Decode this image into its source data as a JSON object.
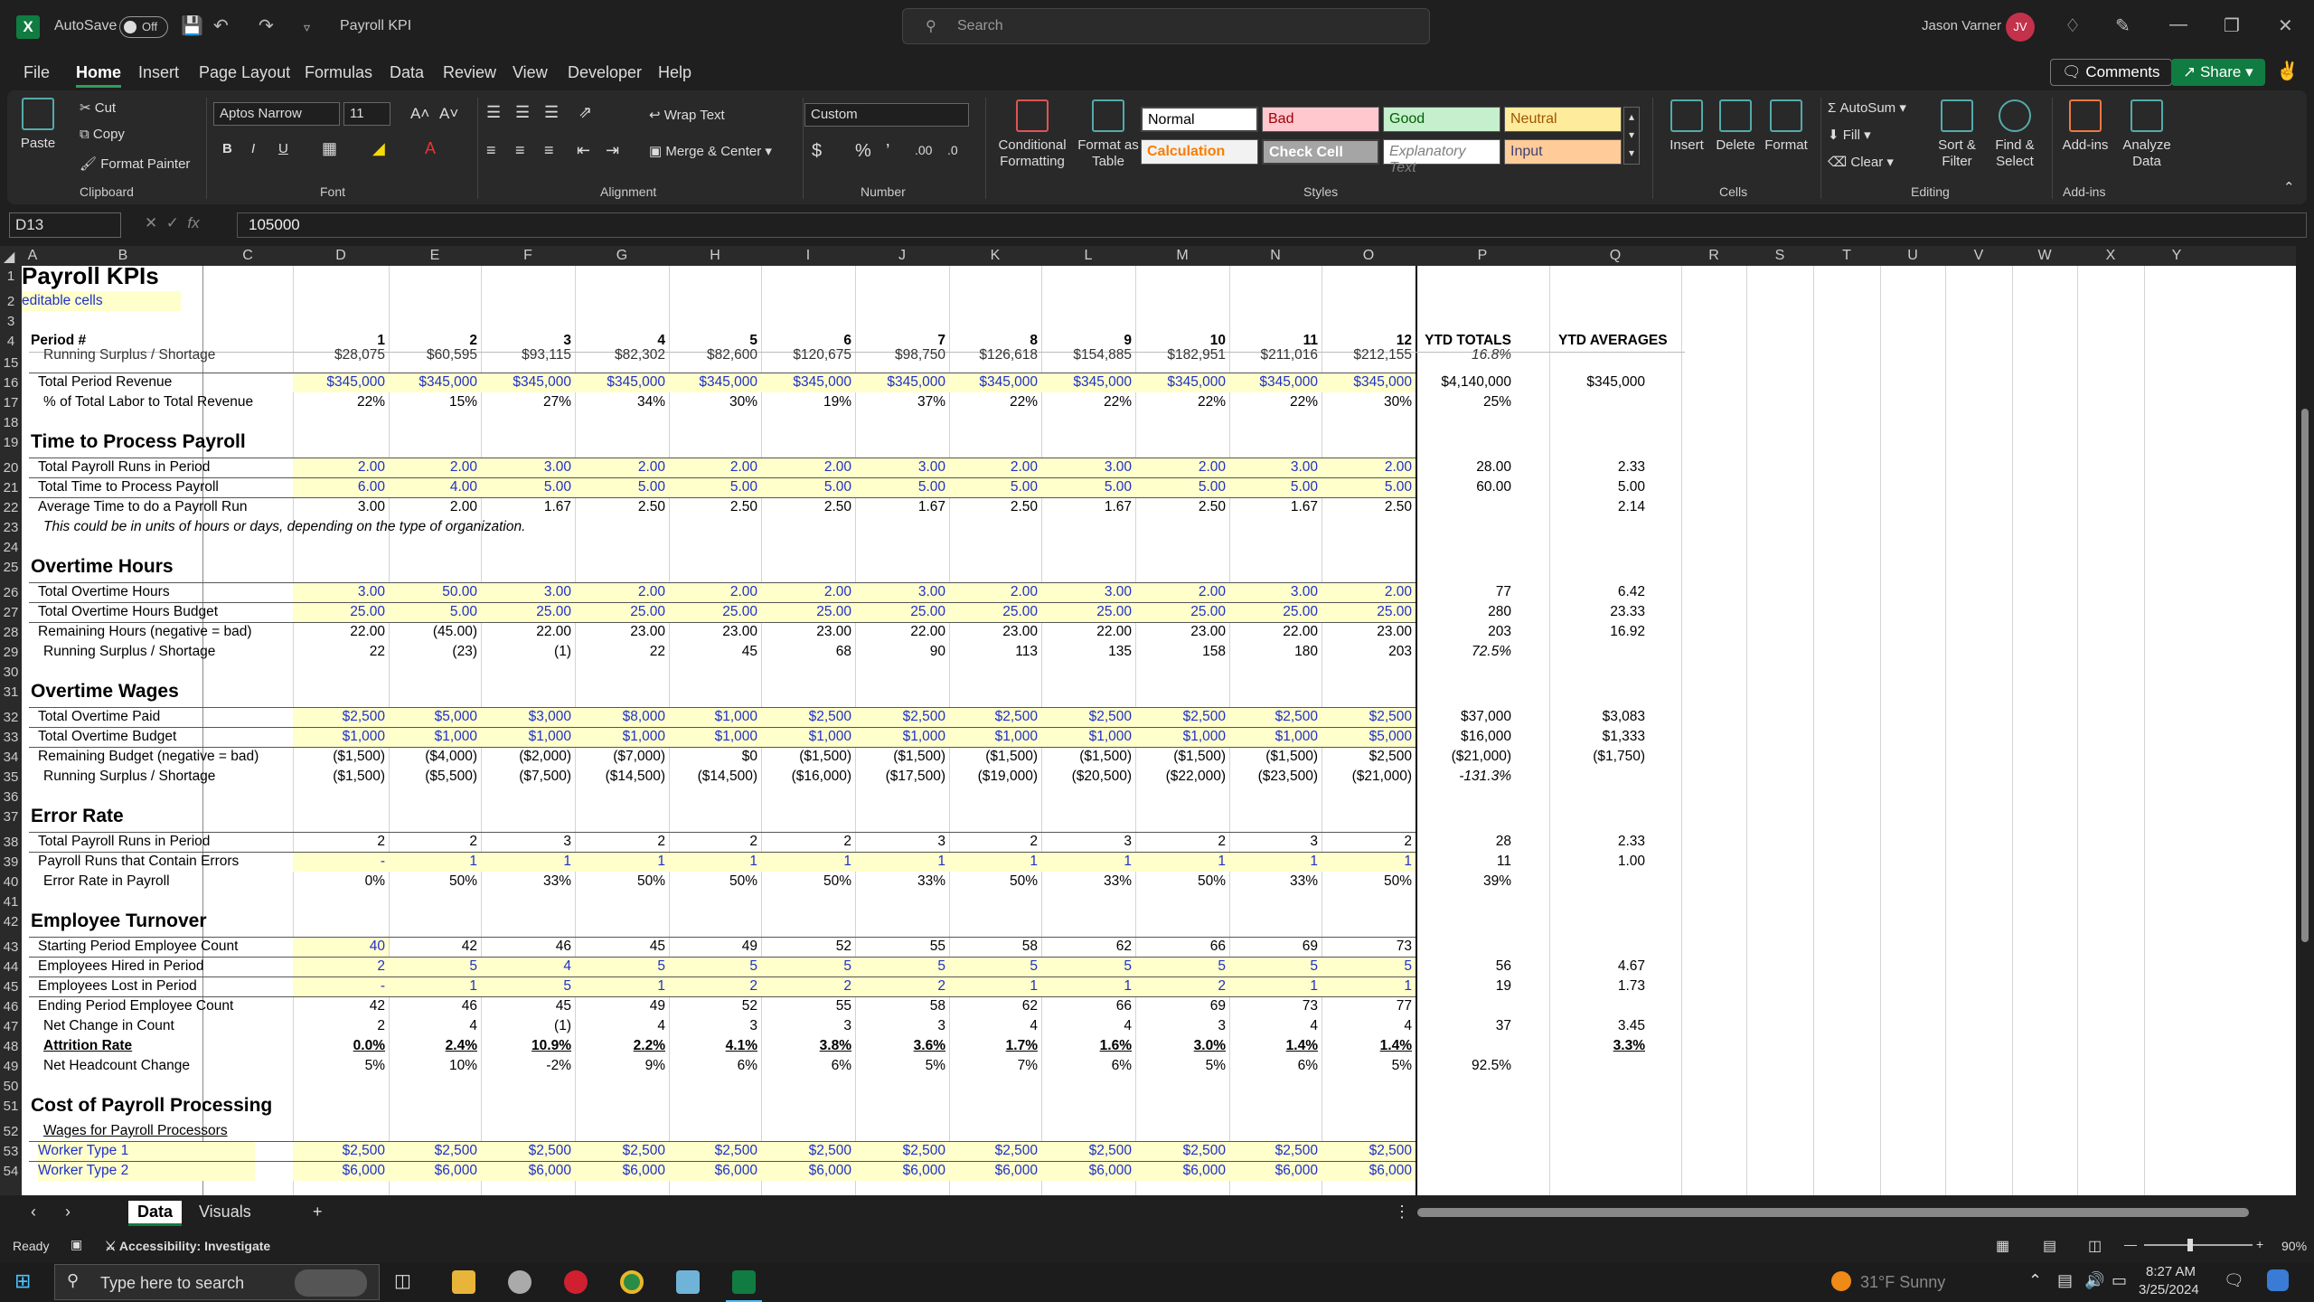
{
  "titlebar": {
    "app_letter": "X",
    "autosave": "AutoSave",
    "autosave_state": "Off",
    "doc_title": "Payroll KPI",
    "search_placeholder": "Search",
    "user_name": "Jason Varner",
    "user_initials": "JV"
  },
  "menu": {
    "tabs": [
      "File",
      "Home",
      "Insert",
      "Page Layout",
      "Formulas",
      "Data",
      "Review",
      "View",
      "Developer",
      "Help"
    ],
    "comments": "Comments",
    "share": "Share"
  },
  "ribbon": {
    "clipboard": {
      "paste": "Paste",
      "cut": "Cut",
      "copy": "Copy",
      "format_painter": "Format Painter",
      "label": "Clipboard"
    },
    "font": {
      "name": "Aptos Narrow",
      "size": "11",
      "bold": "B",
      "italic": "I",
      "underline": "U",
      "label": "Font"
    },
    "alignment": {
      "wrap": "Wrap Text",
      "merge": "Merge & Center",
      "label": "Alignment"
    },
    "number": {
      "format": "Custom",
      "label": "Number"
    },
    "styles": {
      "conditional": "Conditional Formatting",
      "format_table": "Format as Table",
      "normal": "Normal",
      "bad": "Bad",
      "good": "Good",
      "neutral": "Neutral",
      "calculation": "Calculation",
      "check": "Check Cell",
      "explanatory": "Explanatory Text",
      "input": "Input",
      "label": "Styles"
    },
    "cells": {
      "insert": "Insert",
      "delete": "Delete",
      "format": "Format",
      "label": "Cells"
    },
    "editing": {
      "autosum": "AutoSum",
      "fill": "Fill",
      "clear": "Clear",
      "sort": "Sort & Filter",
      "find": "Find & Select",
      "label": "Editing"
    },
    "addins": {
      "addins": "Add-ins",
      "analyze": "Analyze Data",
      "label": "Add-ins"
    }
  },
  "formula_bar": {
    "cell_ref": "D13",
    "value": "105000",
    "fx": "fx"
  },
  "columns": [
    "A",
    "B",
    "C",
    "D",
    "E",
    "F",
    "G",
    "H",
    "I",
    "J",
    "K",
    "L",
    "M",
    "N",
    "O",
    "P",
    "Q",
    "R",
    "S",
    "T",
    "U",
    "V",
    "W",
    "X",
    "Y"
  ],
  "sheet": {
    "title": "Payroll KPIs",
    "editable_note": "editable cells",
    "period_label": "Period #",
    "periods": [
      "1",
      "2",
      "3",
      "4",
      "5",
      "6",
      "7",
      "8",
      "9",
      "10",
      "11",
      "12"
    ],
    "ytd_totals": "YTD TOTALS",
    "ytd_averages": "YTD AVERAGES",
    "row15": {
      "label": "Running Surplus / Shortage",
      "vals": [
        "$28,075",
        "$60,595",
        "$93,115",
        "$82,302",
        "$82,600",
        "$120,675",
        "$98,750",
        "$126,618",
        "$154,885",
        "$182,951",
        "$211,016",
        "$212,155"
      ],
      "ytd": "16.8%",
      "avg": ""
    },
    "row16": {
      "label": "Total Period Revenue",
      "vals": [
        "$345,000",
        "$345,000",
        "$345,000",
        "$345,000",
        "$345,000",
        "$345,000",
        "$345,000",
        "$345,000",
        "$345,000",
        "$345,000",
        "$345,000",
        "$345,000"
      ],
      "ytd": "$4,140,000",
      "avg": "$345,000"
    },
    "row17": {
      "label": "% of Total Labor to Total Revenue",
      "vals": [
        "22%",
        "15%",
        "27%",
        "34%",
        "30%",
        "19%",
        "37%",
        "22%",
        "22%",
        "22%",
        "22%",
        "30%"
      ],
      "ytd": "25%",
      "avg": ""
    },
    "sec_time": "Time to Process Payroll",
    "row20": {
      "label": "Total Payroll Runs in Period",
      "vals": [
        "2.00",
        "2.00",
        "3.00",
        "2.00",
        "2.00",
        "2.00",
        "3.00",
        "2.00",
        "3.00",
        "2.00",
        "3.00",
        "2.00"
      ],
      "ytd": "28.00",
      "avg": "2.33"
    },
    "row21": {
      "label": "Total Time to Process Payroll",
      "vals": [
        "6.00",
        "4.00",
        "5.00",
        "5.00",
        "5.00",
        "5.00",
        "5.00",
        "5.00",
        "5.00",
        "5.00",
        "5.00",
        "5.00"
      ],
      "ytd": "60.00",
      "avg": "5.00"
    },
    "row22": {
      "label": "Average Time to do a Payroll Run",
      "vals": [
        "3.00",
        "2.00",
        "1.67",
        "2.50",
        "2.50",
        "2.50",
        "1.67",
        "2.50",
        "1.67",
        "2.50",
        "1.67",
        "2.50"
      ],
      "ytd": "",
      "avg": "2.14"
    },
    "row23_note": "This could be in units of hours or days, depending on the type of organization.",
    "sec_ot_hours": "Overtime Hours",
    "row26": {
      "label": "Total Overtime Hours",
      "vals": [
        "3.00",
        "50.00",
        "3.00",
        "2.00",
        "2.00",
        "2.00",
        "3.00",
        "2.00",
        "3.00",
        "2.00",
        "3.00",
        "2.00"
      ],
      "ytd": "77",
      "avg": "6.42"
    },
    "row27": {
      "label": "Total Overtime Hours Budget",
      "vals": [
        "25.00",
        "5.00",
        "25.00",
        "25.00",
        "25.00",
        "25.00",
        "25.00",
        "25.00",
        "25.00",
        "25.00",
        "25.00",
        "25.00"
      ],
      "ytd": "280",
      "avg": "23.33"
    },
    "row28": {
      "label": "Remaining Hours (negative = bad)",
      "vals": [
        "22.00",
        "(45.00)",
        "22.00",
        "23.00",
        "23.00",
        "23.00",
        "22.00",
        "23.00",
        "22.00",
        "23.00",
        "22.00",
        "23.00"
      ],
      "ytd": "203",
      "avg": "16.92"
    },
    "row29": {
      "label": "Running Surplus / Shortage",
      "vals": [
        "22",
        "(23)",
        "(1)",
        "22",
        "45",
        "68",
        "90",
        "113",
        "135",
        "158",
        "180",
        "203"
      ],
      "ytd": "72.5%",
      "avg": ""
    },
    "sec_ot_wages": "Overtime Wages",
    "row32": {
      "label": "Total Overtime Paid",
      "vals": [
        "$2,500",
        "$5,000",
        "$3,000",
        "$8,000",
        "$1,000",
        "$2,500",
        "$2,500",
        "$2,500",
        "$2,500",
        "$2,500",
        "$2,500",
        "$2,500"
      ],
      "ytd": "$37,000",
      "avg": "$3,083"
    },
    "row33": {
      "label": "Total Overtime Budget",
      "vals": [
        "$1,000",
        "$1,000",
        "$1,000",
        "$1,000",
        "$1,000",
        "$1,000",
        "$1,000",
        "$1,000",
        "$1,000",
        "$1,000",
        "$1,000",
        "$5,000"
      ],
      "ytd": "$16,000",
      "avg": "$1,333"
    },
    "row34": {
      "label": "Remaining Budget (negative = bad)",
      "vals": [
        "($1,500)",
        "($4,000)",
        "($2,000)",
        "($7,000)",
        "$0",
        "($1,500)",
        "($1,500)",
        "($1,500)",
        "($1,500)",
        "($1,500)",
        "($1,500)",
        "$2,500"
      ],
      "ytd": "($21,000)",
      "avg": "($1,750)"
    },
    "row35": {
      "label": "Running Surplus / Shortage",
      "vals": [
        "($1,500)",
        "($5,500)",
        "($7,500)",
        "($14,500)",
        "($14,500)",
        "($16,000)",
        "($17,500)",
        "($19,000)",
        "($20,500)",
        "($22,000)",
        "($23,500)",
        "($21,000)"
      ],
      "ytd": "-131.3%",
      "avg": ""
    },
    "sec_error": "Error Rate",
    "row38": {
      "label": "Total Payroll Runs in Period",
      "vals": [
        "2",
        "2",
        "3",
        "2",
        "2",
        "2",
        "3",
        "2",
        "3",
        "2",
        "3",
        "2"
      ],
      "ytd": "28",
      "avg": "2.33"
    },
    "row39": {
      "label": "Payroll Runs that Contain Errors",
      "vals": [
        "-",
        "1",
        "1",
        "1",
        "1",
        "1",
        "1",
        "1",
        "1",
        "1",
        "1",
        "1"
      ],
      "ytd": "11",
      "avg": "1.00"
    },
    "row40": {
      "label": "Error Rate in Payroll",
      "vals": [
        "0%",
        "50%",
        "33%",
        "50%",
        "50%",
        "50%",
        "33%",
        "50%",
        "33%",
        "50%",
        "33%",
        "50%"
      ],
      "ytd": "39%",
      "avg": ""
    },
    "sec_turnover": "Employee Turnover",
    "row43": {
      "label": "Starting Period Employee Count",
      "vals": [
        "40",
        "42",
        "46",
        "45",
        "49",
        "52",
        "55",
        "58",
        "62",
        "66",
        "69",
        "73"
      ],
      "ytd": "",
      "avg": ""
    },
    "row44": {
      "label": "Employees Hired in Period",
      "vals": [
        "2",
        "5",
        "4",
        "5",
        "5",
        "5",
        "5",
        "5",
        "5",
        "5",
        "5",
        "5"
      ],
      "ytd": "56",
      "avg": "4.67"
    },
    "row45": {
      "label": "Employees Lost in Period",
      "vals": [
        "-",
        "1",
        "5",
        "1",
        "2",
        "2",
        "2",
        "1",
        "1",
        "2",
        "1",
        "1"
      ],
      "ytd": "19",
      "avg": "1.73"
    },
    "row46": {
      "label": "Ending Period Employee Count",
      "vals": [
        "42",
        "46",
        "45",
        "49",
        "52",
        "55",
        "58",
        "62",
        "66",
        "69",
        "73",
        "77"
      ],
      "ytd": "",
      "avg": ""
    },
    "row47": {
      "label": "Net Change in Count",
      "vals": [
        "2",
        "4",
        "(1)",
        "4",
        "3",
        "3",
        "3",
        "4",
        "4",
        "3",
        "4",
        "4"
      ],
      "ytd": "37",
      "avg": "3.45"
    },
    "row48": {
      "label": "Attrition Rate",
      "vals": [
        "0.0%",
        "2.4%",
        "10.9%",
        "2.2%",
        "4.1%",
        "3.8%",
        "3.6%",
        "1.7%",
        "1.6%",
        "3.0%",
        "1.4%",
        "1.4%"
      ],
      "ytd": "",
      "avg": "3.3%"
    },
    "row49": {
      "label": "Net Headcount Change",
      "vals": [
        "5%",
        "10%",
        "-2%",
        "9%",
        "6%",
        "6%",
        "5%",
        "7%",
        "6%",
        "5%",
        "6%",
        "5%"
      ],
      "ytd": "92.5%",
      "avg": ""
    },
    "sec_cost": "Cost of Payroll Processing",
    "row52_label": "Wages for Payroll Processors",
    "row53": {
      "label": "Worker Type 1",
      "vals": [
        "$2,500",
        "$2,500",
        "$2,500",
        "$2,500",
        "$2,500",
        "$2,500",
        "$2,500",
        "$2,500",
        "$2,500",
        "$2,500",
        "$2,500",
        "$2,500"
      ],
      "ytd": "",
      "avg": ""
    },
    "row54": {
      "label": "Worker Type 2",
      "vals": [
        "$6,000",
        "$6,000",
        "$6,000",
        "$6,000",
        "$6,000",
        "$6,000",
        "$6,000",
        "$6,000",
        "$6,000",
        "$6,000",
        "$6,000",
        "$6,000"
      ],
      "ytd": "",
      "avg": ""
    }
  },
  "row_numbers": [
    "1",
    "2",
    "3",
    "4",
    "15",
    "16",
    "17",
    "18",
    "19",
    "20",
    "21",
    "22",
    "23",
    "24",
    "25",
    "26",
    "27",
    "28",
    "29",
    "30",
    "31",
    "32",
    "33",
    "34",
    "35",
    "36",
    "37",
    "38",
    "39",
    "40",
    "41",
    "42",
    "43",
    "44",
    "45",
    "46",
    "47",
    "48",
    "49",
    "50",
    "51",
    "52",
    "53",
    "54"
  ],
  "sheet_tabs": [
    "Data",
    "Visuals"
  ],
  "status": {
    "ready": "Ready",
    "accessibility": "Accessibility: Investigate",
    "zoom": "90%"
  },
  "taskbar": {
    "search_placeholder": "Type here to search",
    "weather": "31°F  Sunny",
    "time": "8:27 AM",
    "date": "3/25/2024"
  },
  "colors": {
    "accent_green": "#107c41",
    "input_fill": "#ffffcc",
    "input_text": "#1f30c8"
  }
}
